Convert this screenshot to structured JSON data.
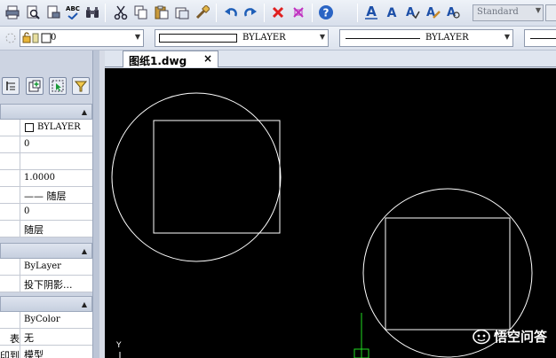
{
  "toolbar": {
    "spell_label": "ABC",
    "text_style_value": "Standard"
  },
  "layer_bar": {
    "layer_value": "0",
    "color_value": "BYLAYER",
    "linetype_value": "BYLAYER"
  },
  "tabs": [
    {
      "label": "图纸1.dwg",
      "close": "×"
    }
  ],
  "properties": {
    "general": [
      {
        "key": "",
        "value": "BYLAYER",
        "swatch": true
      },
      {
        "key": "",
        "value": "0"
      },
      {
        "key": "",
        "value": ""
      },
      {
        "key": "",
        "value": "1.0000"
      },
      {
        "key": "",
        "value": "—— 随层"
      },
      {
        "key": "",
        "value": "0"
      },
      {
        "key": "",
        "value": "随层"
      }
    ],
    "section2": [
      {
        "key": "",
        "value": "ByLayer"
      },
      {
        "key": "",
        "value": "投下阴影..."
      }
    ],
    "section3": [
      {
        "key": "",
        "value": "ByColor"
      },
      {
        "key": "表",
        "value": "无"
      },
      {
        "key": "印到",
        "value": "模型"
      }
    ]
  },
  "canvas": {
    "background": "#000000",
    "stroke": "#ffffff",
    "ucs_axis_label": "Y",
    "ucs_color": "#22dd22"
  },
  "watermark": {
    "text": "悟空问答"
  },
  "colors": {
    "delete_red": "#e02020",
    "undo_blue": "#1f5fb8",
    "help_blue": "#2a64c4"
  }
}
